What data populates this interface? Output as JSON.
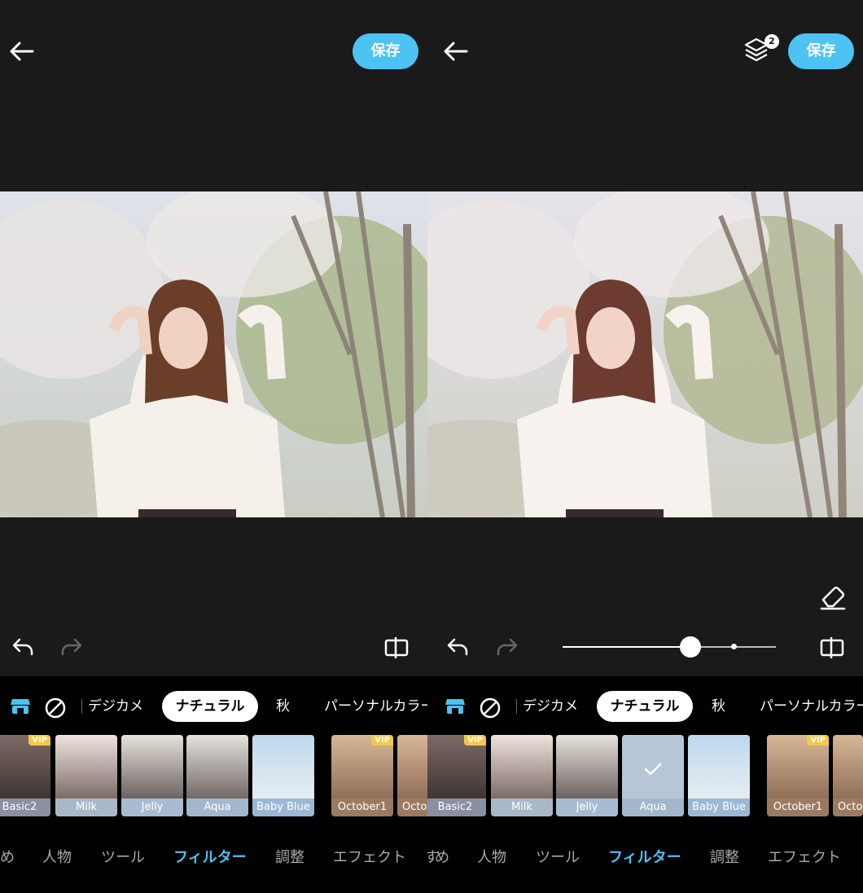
{
  "left": {
    "save_label": "保存",
    "categories": [
      "デジカメ",
      "ナチュラル",
      "秋",
      "パーソナルカラー"
    ],
    "thumbs": [
      {
        "label": "Basic2",
        "vip": "VIP"
      },
      {
        "label": "Milk"
      },
      {
        "label": "Jelly"
      },
      {
        "label": "Aqua"
      },
      {
        "label": "Baby Blue"
      },
      {
        "label": "October1",
        "vip": "VIP"
      },
      {
        "label": "Octo"
      }
    ],
    "tabs": [
      "め",
      "人物",
      "ツール",
      "フィルター",
      "調整",
      "エフェクト"
    ]
  },
  "right": {
    "save_label": "保存",
    "layers_badge": "2",
    "slider": {
      "value": 0.6,
      "marker": 0.8
    },
    "categories": [
      "デジカメ",
      "ナチュラル",
      "秋",
      "パーソナルカラー"
    ],
    "thumbs": [
      {
        "label": "Basic2",
        "vip": "VIP"
      },
      {
        "label": "Milk"
      },
      {
        "label": "Jelly"
      },
      {
        "label": "Aqua",
        "selected": true
      },
      {
        "label": "Baby Blue"
      },
      {
        "label": "October1",
        "vip": "VIP"
      },
      {
        "label": "Octo"
      }
    ],
    "tabs": [
      "す",
      "め",
      "人物",
      "ツール",
      "フィルター",
      "調整",
      "エフェクト"
    ]
  },
  "colors": {
    "accent": "#4cc3f3",
    "background": "#1a1a1b",
    "vip": "#f5c84b"
  }
}
